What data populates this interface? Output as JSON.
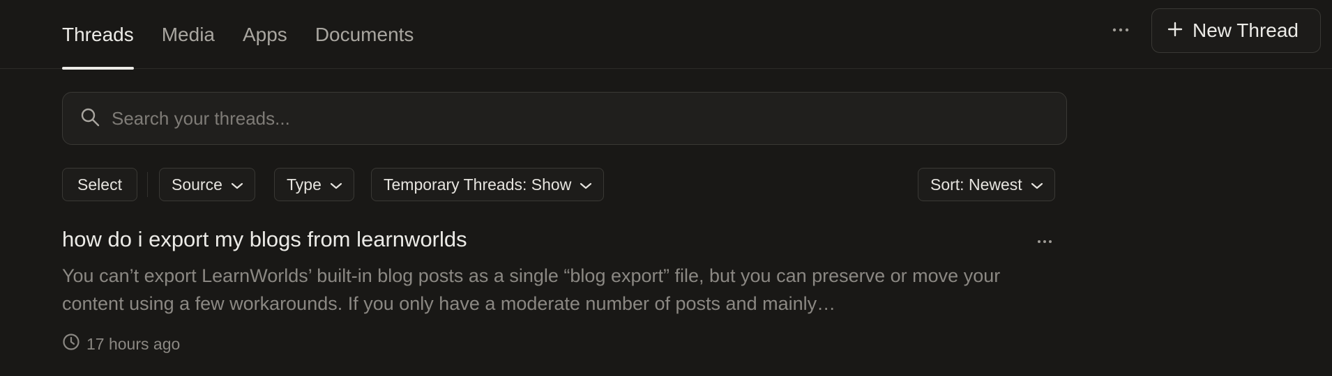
{
  "nav": {
    "tabs": [
      {
        "label": "Threads",
        "active": true
      },
      {
        "label": "Media",
        "active": false
      },
      {
        "label": "Apps",
        "active": false
      },
      {
        "label": "Documents",
        "active": false
      }
    ],
    "more_icon": "ellipsis-icon",
    "new_thread_label": "New Thread"
  },
  "search": {
    "placeholder": "Search your threads...",
    "value": ""
  },
  "filters": {
    "select_label": "Select",
    "source_label": "Source",
    "type_label": "Type",
    "temporary_label": "Temporary Threads: Show",
    "sort_label": "Sort: Newest"
  },
  "threads": [
    {
      "title": "how do i export my blogs from learnworlds",
      "snippet": "You can’t export LearnWorlds’ built-in blog posts as a single “blog export” file, but you can preserve or move your content using a few workarounds. If you only have a moderate number of posts and mainly…",
      "time": "17 hours ago"
    }
  ],
  "colors": {
    "background": "#191816",
    "text_primary": "#ecebe7",
    "text_secondary": "#8b8883",
    "border": "#3a3935"
  }
}
